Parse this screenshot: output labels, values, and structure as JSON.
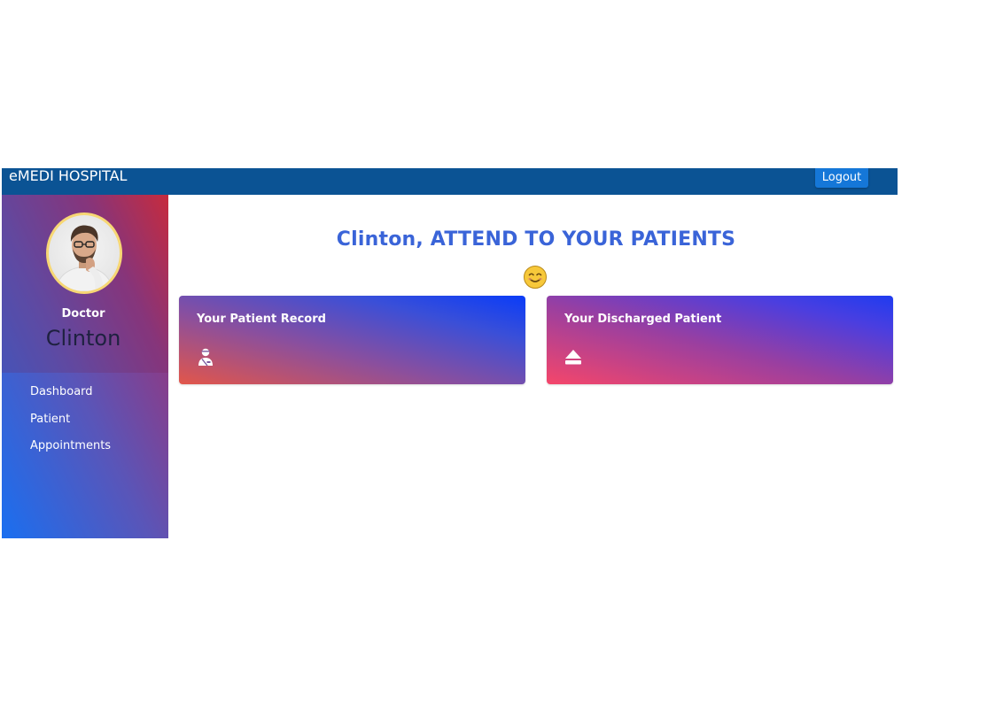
{
  "navbar": {
    "brand": "eMEDI HOSPITAL",
    "logout_label": "Logout"
  },
  "sidebar": {
    "role_label": "Doctor",
    "doctor_name": "Clinton",
    "items": [
      {
        "label": "Dashboard"
      },
      {
        "label": "Patient"
      },
      {
        "label": "Appointments"
      }
    ]
  },
  "main": {
    "greeting": "Clinton, ATTEND TO YOUR PATIENTS",
    "cards": [
      {
        "title": "Your Patient Record",
        "icon": "user-injured-icon"
      },
      {
        "title": "Your Discharged Patient",
        "icon": "eject-icon"
      }
    ]
  },
  "colors": {
    "navbar": "#0b5394",
    "logout_button": "#1577d8",
    "greeting_text": "#3a64d8",
    "avatar_border": "#f7d774"
  }
}
